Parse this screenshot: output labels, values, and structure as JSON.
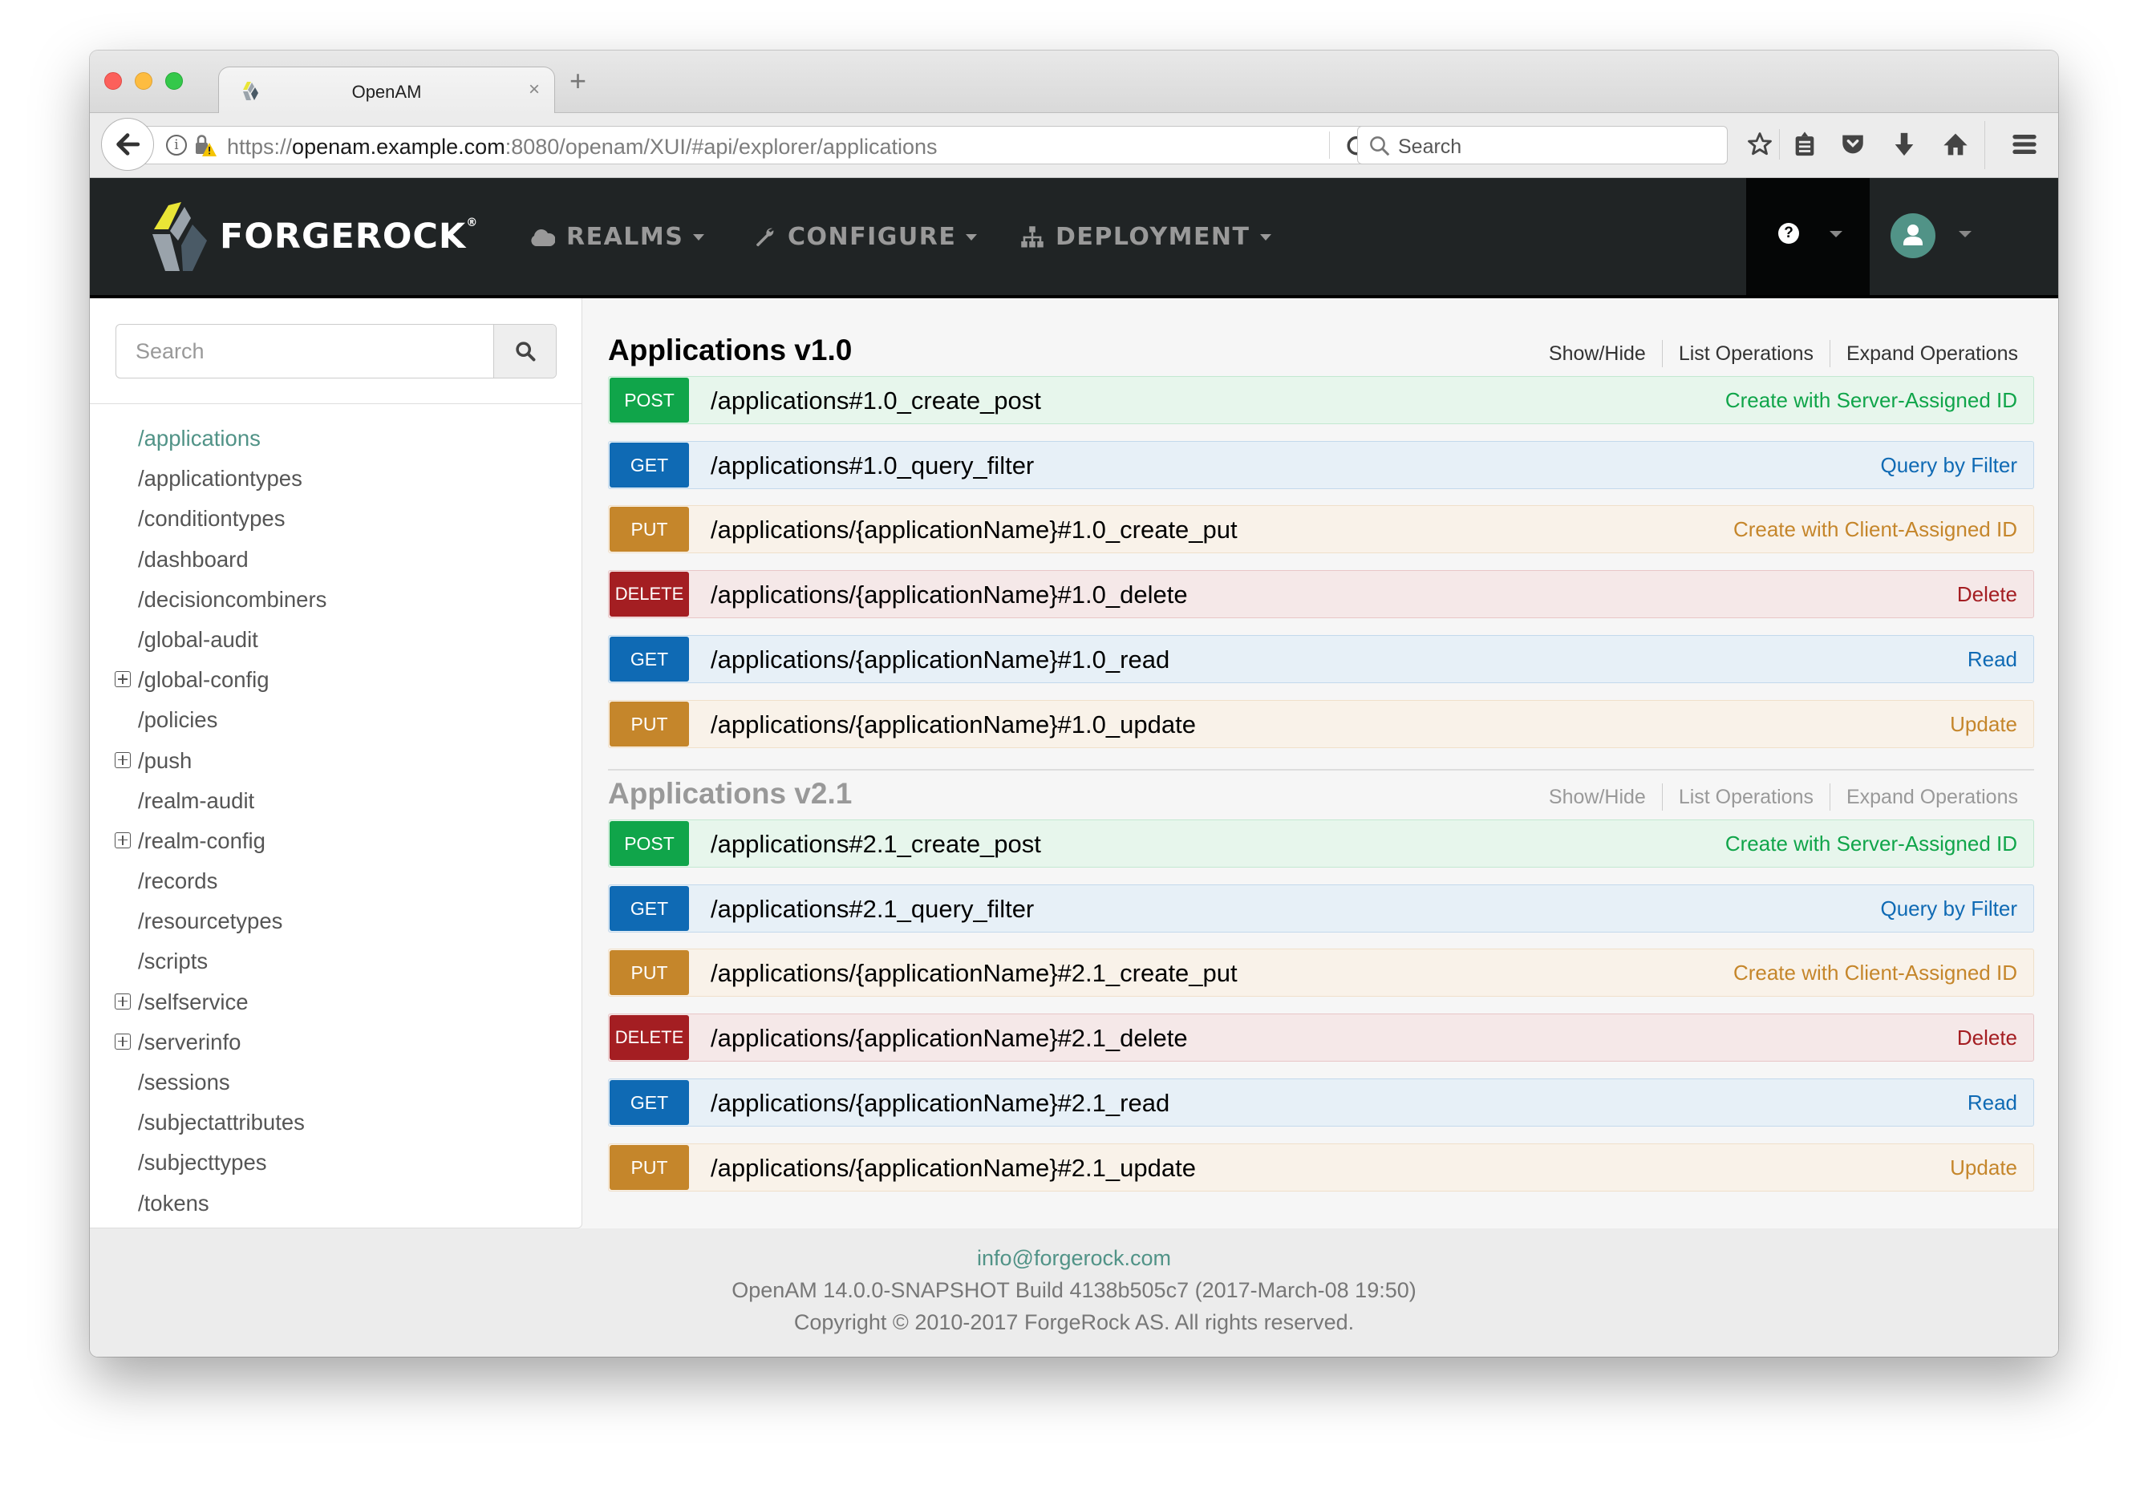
{
  "browser": {
    "tab_title": "OpenAM",
    "url_scheme": "https://",
    "url_host": "openam.example.com",
    "url_rest": ":8080/openam/XUI/#api/explorer/applications",
    "search_placeholder": "Search",
    "toolbar_icons": [
      "star-icon",
      "reading-list-icon",
      "pocket-icon",
      "download-icon",
      "home-icon",
      "menu-icon"
    ]
  },
  "app_nav": {
    "brand": "FORGEROCK",
    "items": [
      {
        "label": "REALMS",
        "icon": "cloud-icon"
      },
      {
        "label": "CONFIGURE",
        "icon": "wrench-icon"
      },
      {
        "label": "DEPLOYMENT",
        "icon": "sitemap-icon"
      }
    ],
    "help_icon": "question-circle-icon",
    "user_icon": "user-icon",
    "accent": "#519387"
  },
  "sidebar": {
    "search_placeholder": "Search",
    "items": [
      {
        "label": "/applications",
        "expandable": false,
        "active": true
      },
      {
        "label": "/applicationtypes",
        "expandable": false
      },
      {
        "label": "/conditiontypes",
        "expandable": false
      },
      {
        "label": "/dashboard",
        "expandable": false
      },
      {
        "label": "/decisioncombiners",
        "expandable": false
      },
      {
        "label": "/global-audit",
        "expandable": false
      },
      {
        "label": "/global-config",
        "expandable": true
      },
      {
        "label": "/policies",
        "expandable": false
      },
      {
        "label": "/push",
        "expandable": true
      },
      {
        "label": "/realm-audit",
        "expandable": false
      },
      {
        "label": "/realm-config",
        "expandable": true
      },
      {
        "label": "/records",
        "expandable": false
      },
      {
        "label": "/resourcetypes",
        "expandable": false
      },
      {
        "label": "/scripts",
        "expandable": false
      },
      {
        "label": "/selfservice",
        "expandable": true
      },
      {
        "label": "/serverinfo",
        "expandable": true
      },
      {
        "label": "/sessions",
        "expandable": false
      },
      {
        "label": "/subjectattributes",
        "expandable": false
      },
      {
        "label": "/subjecttypes",
        "expandable": false
      },
      {
        "label": "/tokens",
        "expandable": false
      }
    ]
  },
  "main": {
    "section_links": [
      "Show/Hide",
      "List Operations",
      "Expand Operations"
    ],
    "sections": [
      {
        "title": "Applications v1.0",
        "operations": [
          {
            "method": "POST",
            "path": "/applications#1.0_create_post",
            "description": "Create with Server-Assigned ID"
          },
          {
            "method": "GET",
            "path": "/applications#1.0_query_filter",
            "description": "Query by Filter"
          },
          {
            "method": "PUT",
            "path": "/applications/{applicationName}#1.0_create_put",
            "description": "Create with Client-Assigned ID"
          },
          {
            "method": "DELETE",
            "path": "/applications/{applicationName}#1.0_delete",
            "description": "Delete"
          },
          {
            "method": "GET",
            "path": "/applications/{applicationName}#1.0_read",
            "description": "Read"
          },
          {
            "method": "PUT",
            "path": "/applications/{applicationName}#1.0_update",
            "description": "Update"
          }
        ]
      },
      {
        "title": "Applications v2.1",
        "operations": [
          {
            "method": "POST",
            "path": "/applications#2.1_create_post",
            "description": "Create with Server-Assigned ID"
          },
          {
            "method": "GET",
            "path": "/applications#2.1_query_filter",
            "description": "Query by Filter"
          },
          {
            "method": "PUT",
            "path": "/applications/{applicationName}#2.1_create_put",
            "description": "Create with Client-Assigned ID"
          },
          {
            "method": "DELETE",
            "path": "/applications/{applicationName}#2.1_delete",
            "description": "Delete"
          },
          {
            "method": "GET",
            "path": "/applications/{applicationName}#2.1_read",
            "description": "Read"
          },
          {
            "method": "PUT",
            "path": "/applications/{applicationName}#2.1_update",
            "description": "Update"
          }
        ]
      }
    ],
    "method_colors": {
      "POST": "#10a54a",
      "GET": "#0f6ab4",
      "PUT": "#c5862b",
      "DELETE": "#a41e22"
    }
  },
  "footer": {
    "email": "info@forgerock.com",
    "build": "OpenAM 14.0.0-SNAPSHOT Build 4138b505c7 (2017-March-08 19:50)",
    "copyright": "Copyright © 2010-2017 ForgeRock AS. All rights reserved."
  }
}
